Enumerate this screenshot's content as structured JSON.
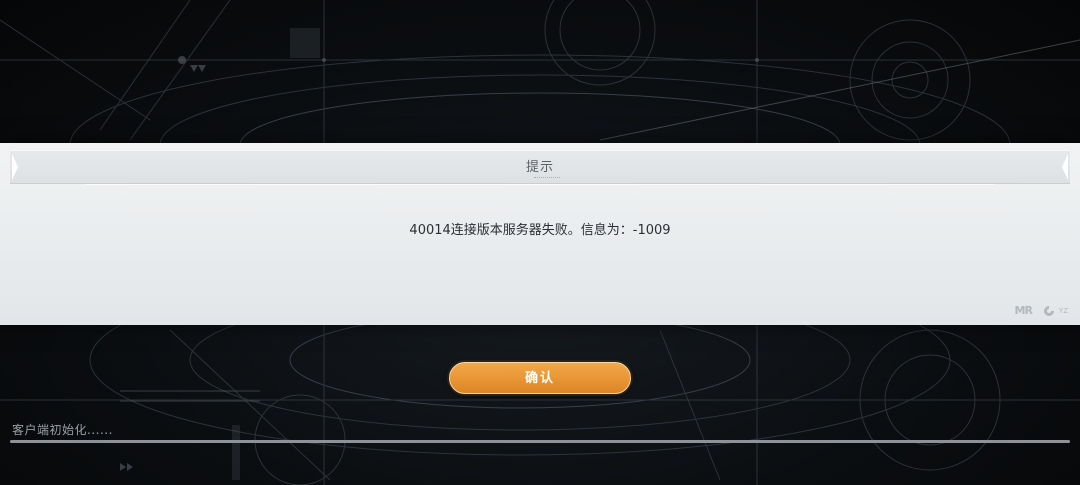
{
  "dialog": {
    "title": "提示",
    "message": "40014连接版本服务器失败。信息为：-1009",
    "confirm_label": "确认"
  },
  "logos": {
    "left": "MR",
    "right": "YZ"
  },
  "loading": {
    "status_text": "客户端初始化......",
    "progress": 1.0
  },
  "colors": {
    "button": "#e99534",
    "dialog_bg": "#eceff1",
    "background": "#0b0e11"
  }
}
